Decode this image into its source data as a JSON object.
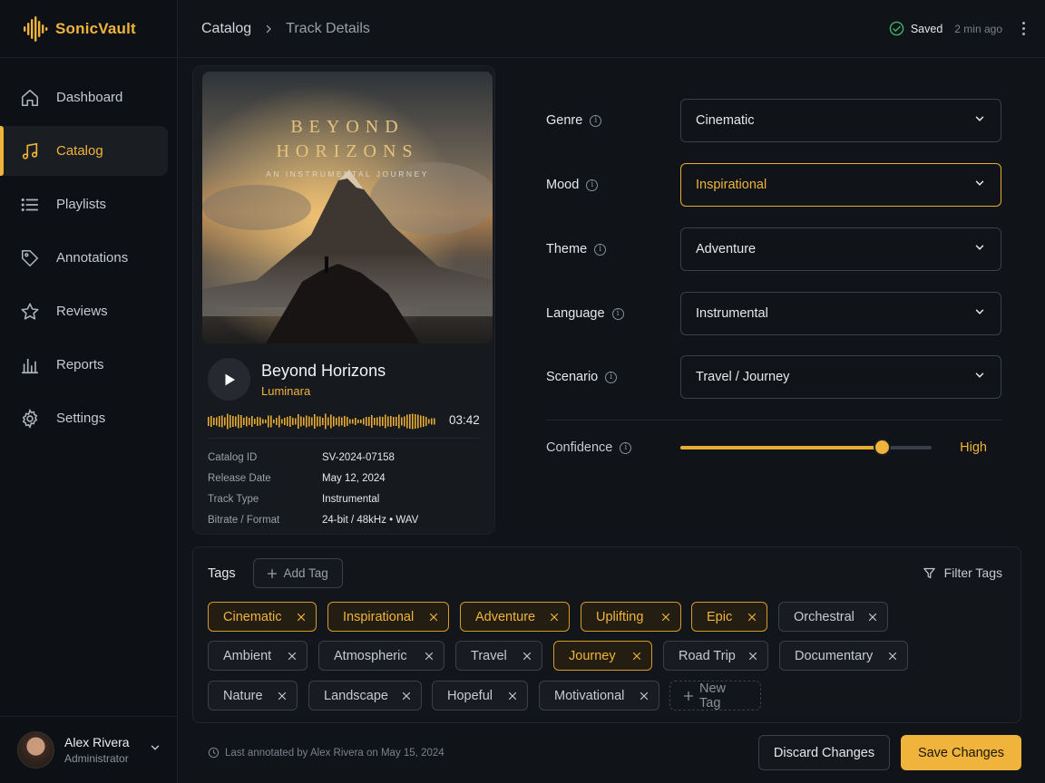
{
  "app": {
    "name": "SonicVault",
    "accent": "#f0b43c"
  },
  "sidebar": {
    "items": [
      {
        "label": "Dashboard",
        "icon": "home-icon"
      },
      {
        "label": "Catalog",
        "icon": "music-note-icon",
        "active": true
      },
      {
        "label": "Playlists",
        "icon": "list-icon"
      },
      {
        "label": "Annotations",
        "icon": "tag-icon"
      },
      {
        "label": "Reviews",
        "icon": "star-icon"
      },
      {
        "label": "Reports",
        "icon": "bar-chart-icon"
      },
      {
        "label": "Settings",
        "icon": "gear-icon"
      }
    ]
  },
  "user": {
    "name": "Alex Rivera",
    "role": "Administrator"
  },
  "breadcrumb": {
    "parent": "Catalog",
    "current": "Track Details"
  },
  "status": {
    "saved": "Saved",
    "ago": "2 min ago"
  },
  "artwork": {
    "title_line1": "BEYOND",
    "title_line2": "HORIZONS",
    "subtitle": "AN INSTRUMENTAL JOURNEY"
  },
  "track": {
    "title": "Beyond Horizons",
    "artist": "Luminara",
    "duration": "03:42",
    "meta": [
      {
        "label": "Catalog ID",
        "value": "SV-2024-07158"
      },
      {
        "label": "Release Date",
        "value": "May 12, 2024"
      },
      {
        "label": "Track Type",
        "value": "Instrumental"
      },
      {
        "label": "Bitrate / Format",
        "value": "24-bit / 48kHz • WAV"
      }
    ]
  },
  "fields": [
    {
      "label": "Genre",
      "value": "Cinematic"
    },
    {
      "label": "Mood",
      "value": "Inspirational",
      "highlighted": true
    },
    {
      "label": "Theme",
      "value": "Adventure"
    },
    {
      "label": "Language",
      "value": "Instrumental"
    },
    {
      "label": "Scenario",
      "value": "Travel / Journey"
    }
  ],
  "confidence": {
    "label": "Confidence",
    "value_label": "High",
    "level": 0.8
  },
  "tags": {
    "title": "Tags",
    "add_label": "Add Tag",
    "filter_label": "Filter Tags",
    "new_label": "New Tag",
    "items": [
      {
        "label": "Cinematic",
        "selected": true
      },
      {
        "label": "Inspirational",
        "selected": true
      },
      {
        "label": "Adventure",
        "selected": true
      },
      {
        "label": "Uplifting",
        "selected": true
      },
      {
        "label": "Epic",
        "selected": true
      },
      {
        "label": "Orchestral",
        "selected": false
      },
      {
        "label": "Ambient",
        "selected": false
      },
      {
        "label": "Atmospheric",
        "selected": false
      },
      {
        "label": "Travel",
        "selected": false
      },
      {
        "label": "Journey",
        "selected": true
      },
      {
        "label": "Road Trip",
        "selected": false
      },
      {
        "label": "Documentary",
        "selected": false
      },
      {
        "label": "Nature",
        "selected": false
      },
      {
        "label": "Landscape",
        "selected": false
      },
      {
        "label": "Hopeful",
        "selected": false
      },
      {
        "label": "Motivational",
        "selected": false
      }
    ]
  },
  "footer": {
    "note": "Last annotated by Alex Rivera on May 15, 2024",
    "discard": "Discard Changes",
    "save": "Save Changes"
  }
}
